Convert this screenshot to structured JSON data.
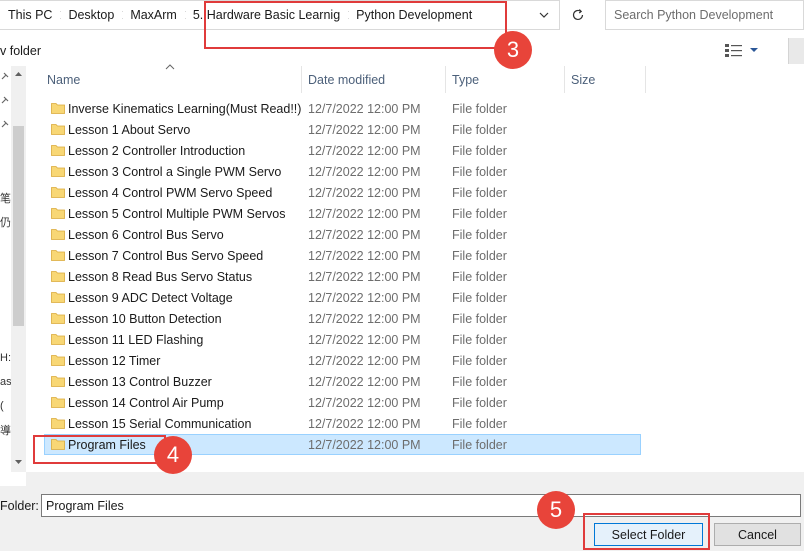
{
  "address": {
    "crumbs": [
      "This PC",
      "Desktop",
      "MaxArm",
      "5. Hardware Basic Learnig",
      "Python Development"
    ]
  },
  "search": {
    "placeholder": "Search Python Development"
  },
  "toolbar": {
    "new_folder_label": "v folder"
  },
  "nav_glyphs": [
    "笔",
    "仍",
    "H:",
    "ase",
    "(",
    "導"
  ],
  "columns": {
    "name": "Name",
    "date": "Date modified",
    "type": "Type",
    "size": "Size"
  },
  "files": [
    {
      "name": "Inverse Kinematics Learning(Must Read!!)",
      "date": "12/7/2022 12:00 PM",
      "type": "File folder"
    },
    {
      "name": "Lesson 1 About Servo",
      "date": "12/7/2022 12:00 PM",
      "type": "File folder"
    },
    {
      "name": "Lesson 2 Controller Introduction",
      "date": "12/7/2022 12:00 PM",
      "type": "File folder"
    },
    {
      "name": "Lesson 3 Control a Single PWM Servo",
      "date": "12/7/2022 12:00 PM",
      "type": "File folder"
    },
    {
      "name": "Lesson 4 Control PWM Servo Speed",
      "date": "12/7/2022 12:00 PM",
      "type": "File folder"
    },
    {
      "name": "Lesson 5 Control Multiple PWM Servos",
      "date": "12/7/2022 12:00 PM",
      "type": "File folder"
    },
    {
      "name": "Lesson 6 Control Bus Servo",
      "date": "12/7/2022 12:00 PM",
      "type": "File folder"
    },
    {
      "name": "Lesson 7 Control Bus Servo Speed",
      "date": "12/7/2022 12:00 PM",
      "type": "File folder"
    },
    {
      "name": "Lesson 8 Read Bus Servo Status",
      "date": "12/7/2022 12:00 PM",
      "type": "File folder"
    },
    {
      "name": "Lesson 9 ADC Detect Voltage",
      "date": "12/7/2022 12:00 PM",
      "type": "File folder"
    },
    {
      "name": "Lesson 10 Button Detection",
      "date": "12/7/2022 12:00 PM",
      "type": "File folder"
    },
    {
      "name": "Lesson 11 LED Flashing",
      "date": "12/7/2022 12:00 PM",
      "type": "File folder"
    },
    {
      "name": "Lesson 12 Timer",
      "date": "12/7/2022 12:00 PM",
      "type": "File folder"
    },
    {
      "name": "Lesson 13 Control Buzzer",
      "date": "12/7/2022 12:00 PM",
      "type": "File folder"
    },
    {
      "name": "Lesson 14 Control Air Pump",
      "date": "12/7/2022 12:00 PM",
      "type": "File folder"
    },
    {
      "name": "Lesson 15 Serial Communication",
      "date": "12/7/2022 12:00 PM",
      "type": "File folder"
    },
    {
      "name": "Program Files",
      "date": "12/7/2022 12:00 PM",
      "type": "File folder"
    }
  ],
  "selected_index": 16,
  "footer": {
    "folder_label": "Folder:",
    "folder_value": "Program Files",
    "select_button": "Select Folder",
    "cancel_button": "Cancel"
  },
  "annotations": {
    "step_3": "3",
    "step_4": "4",
    "step_5": "5"
  },
  "colors": {
    "selection": "#cce8ff",
    "annotation_red": "#e8443a",
    "folder_yellow": "#f8d775"
  }
}
